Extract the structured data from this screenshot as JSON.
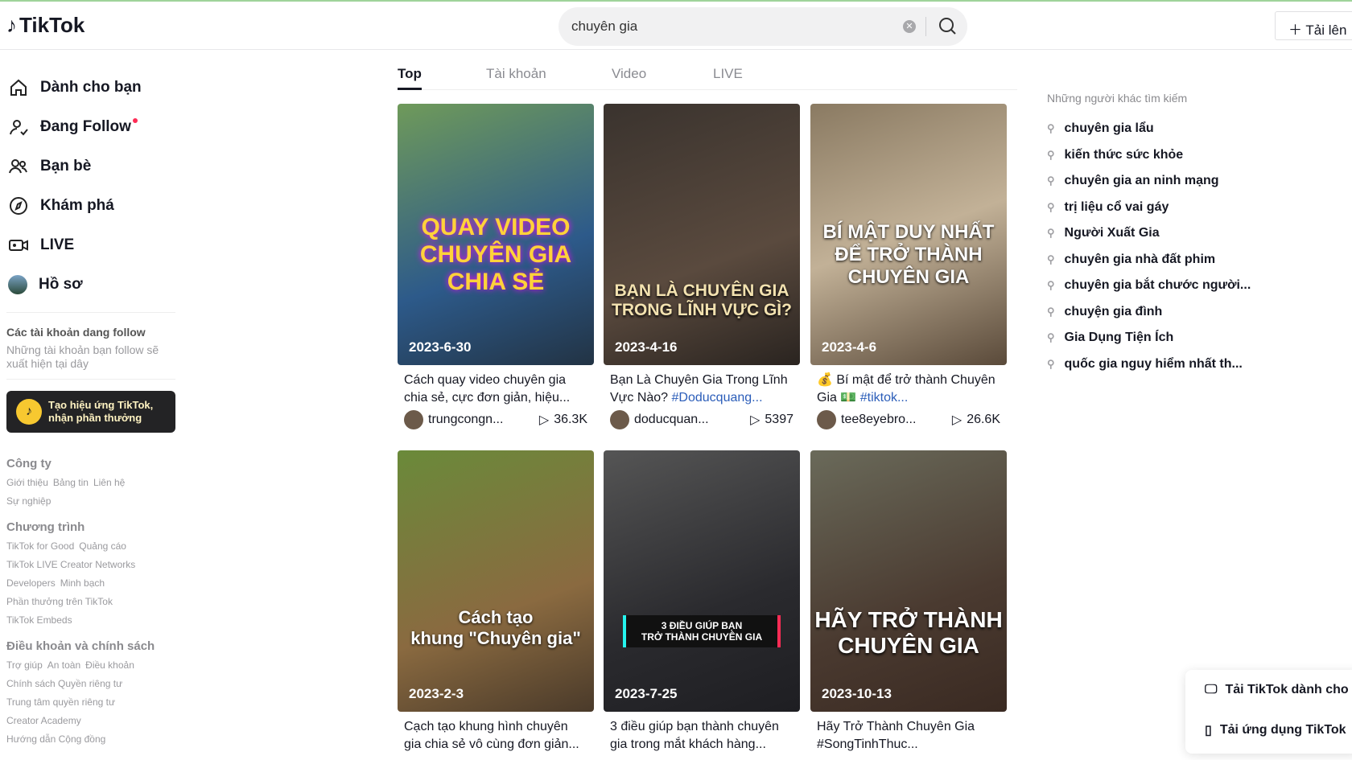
{
  "header": {
    "logo": "TikTok",
    "search_value": "chuyên gia",
    "upload_label": "Tải lên"
  },
  "sidebar": {
    "items": [
      {
        "label": "Dành cho bạn",
        "icon": "home-icon"
      },
      {
        "label": "Đang Follow",
        "icon": "following-icon"
      },
      {
        "label": "Bạn bè",
        "icon": "friends-icon"
      },
      {
        "label": "Khám phá",
        "icon": "compass-icon"
      },
      {
        "label": "LIVE",
        "icon": "live-icon"
      },
      {
        "label": "Hồ sơ",
        "icon": "avatar"
      }
    ],
    "following_title": "Các tài khoản dang follow",
    "following_sub": "Những tài khoản bạn follow sẽ xuất hiện tại dây",
    "promo": "Tạo hiệu ứng TikTok, nhận phần thưởng",
    "footer": [
      {
        "title": "Công ty",
        "lines": [
          [
            "Giới thiệu",
            "Bảng tin",
            "Liên hệ"
          ],
          [
            "Sự nghiệp"
          ]
        ]
      },
      {
        "title": "Chương trình",
        "lines": [
          [
            "TikTok for Good",
            "Quảng cáo"
          ],
          [
            "TikTok LIVE Creator Networks"
          ],
          [
            "Developers",
            "Minh bạch"
          ],
          [
            "Phần thưởng trên TikTok"
          ],
          [
            "TikTok Embeds"
          ]
        ]
      },
      {
        "title": "Điều khoản và chính sách",
        "lines": [
          [
            "Trợ giúp",
            "An toàn",
            "Điều khoản"
          ],
          [
            "Chính sách Quyền riêng tư"
          ],
          [
            "Trung tâm quyền riêng tư"
          ],
          [
            "Creator Academy"
          ],
          [
            "Hướng dẫn Cộng đồng"
          ]
        ]
      }
    ]
  },
  "tabs": [
    "Top",
    "Tài khoản",
    "Video",
    "LIVE"
  ],
  "videos": [
    {
      "overlay": "QUAY VIDEO\nCHUYÊN GIA\nCHIA SẺ",
      "date": "2023-6-30",
      "caption": "Cách quay video chuyên gia chia sẻ, cực đơn giản, hiệu...",
      "tag": "",
      "user": "trungcongn...",
      "views": "36.3K"
    },
    {
      "overlay": "BẠN LÀ CHUYÊN GIA\nTRONG LĨNH VỰC GÌ?",
      "date": "2023-4-16",
      "caption": "Bạn Là Chuyên Gia Trong Lĩnh Vực Nào? ",
      "tag": "#Doducquang...",
      "user": "doducquan...",
      "views": "5397"
    },
    {
      "overlay": "BÍ MẬT DUY NHẤT\nĐỂ TRỞ THÀNH\nCHUYÊN GIA",
      "date": "2023-4-6",
      "caption": "💰 Bí mật để trở thành Chuyên Gia 💵 ",
      "tag": "#tiktok...",
      "user": "tee8eyebro...",
      "views": "26.6K"
    },
    {
      "overlay": "Cách tạo\nkhung \"Chuyên gia\"",
      "date": "2023-2-3",
      "caption": "Cạch tạo khung hình chuyên gia chia sẻ vô cùng đơn giản...",
      "tag": "",
      "user": "",
      "views": ""
    },
    {
      "overlay": "3 ĐIỀU GIÚP BẠN\nTRỞ THÀNH CHUYÊN GIA",
      "date": "2023-7-25",
      "caption": "3 điều giúp bạn thành chuyên gia trong mắt khách hàng...",
      "tag": "",
      "user": "",
      "views": ""
    },
    {
      "overlay": "HÃY TRỞ THÀNH\nCHUYÊN GIA",
      "date": "2023-10-13",
      "caption": "Hãy Trở Thành Chuyên Gia #SongTinhThuc...",
      "tag": "",
      "user": "",
      "views": ""
    }
  ],
  "related": {
    "title": "Những người khác tìm kiếm",
    "items": [
      "chuyên gia lẩu",
      "kiến thức sức khỏe",
      "chuyên gia an ninh mạng",
      "trị liệu cổ vai gáy",
      "Người Xuất Gia",
      "chuyên gia nhà đất phim",
      "chuyên gia bắt chước người...",
      "chuyện gia đình",
      "Gia Dụng Tiện Ích",
      "quốc gia nguy hiểm nhất th..."
    ]
  },
  "popup": {
    "desktop": "Tải TikTok dành cho máy tính",
    "mobile": "Tải ứng dụng TikTok"
  }
}
